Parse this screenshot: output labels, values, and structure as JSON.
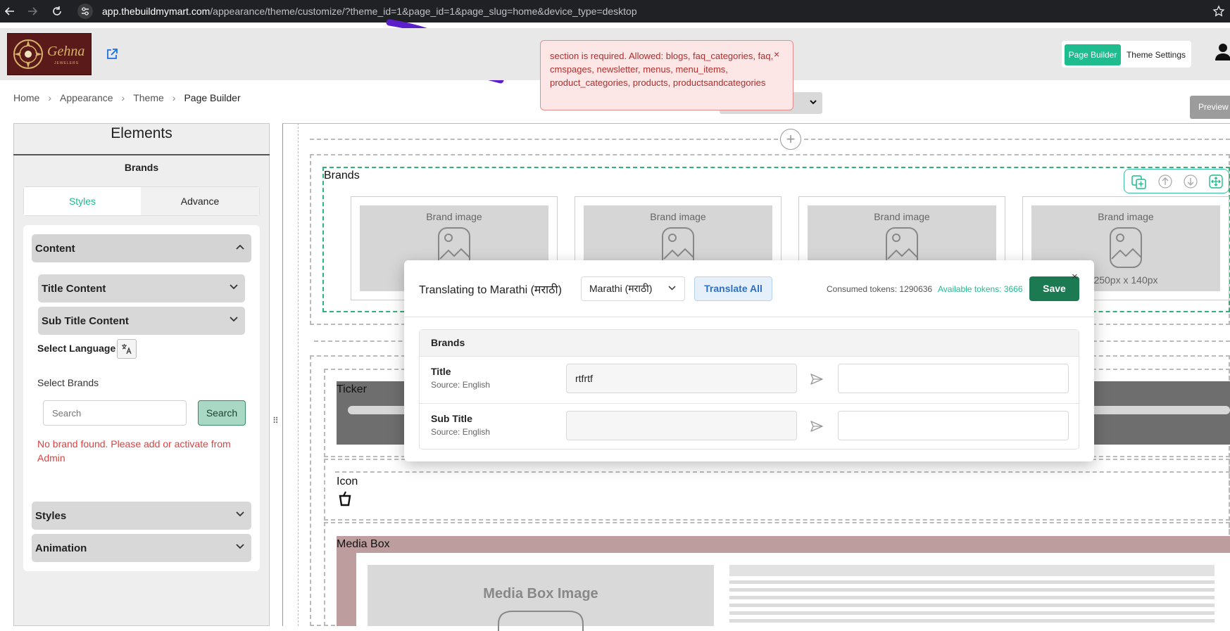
{
  "browser": {
    "url_host": "app.thebuildmymart.com",
    "url_path": "/appearance/theme/customize/?theme_id=1&page_id=1&page_slug=home&device_type=desktop"
  },
  "header": {
    "logo_text": "Gehna",
    "logo_sub": "JEWELERS",
    "tab_page_builder": "Page Builder",
    "tab_theme_settings": "Theme Settings"
  },
  "breadcrumb": [
    "Home",
    "Appearance",
    "Theme",
    "Page Builder"
  ],
  "preview_label": "Preview",
  "sidebar": {
    "title": "Elements",
    "element_name": "Brands",
    "tabs": [
      "Styles",
      "Advance"
    ],
    "active_tab": "Styles",
    "content_accordion": "Content",
    "title_content": "Title Content",
    "sub_title_content": "Sub Title Content",
    "select_language": "Select Language",
    "select_brands": "Select Brands",
    "search_placeholder": "Search",
    "search_button": "Search",
    "no_brand_message": "No brand found. Please add or activate from Admin",
    "styles_accordion": "Styles",
    "animation_accordion": "Animation"
  },
  "canvas": {
    "brands_title": "Brands",
    "brand_image_label": "Brand image",
    "brand_size_label": "250px x 140px",
    "ticker_title": "Ticker",
    "icon_title": "Icon",
    "mediabox_title": "Media Box",
    "mediabox_image_label": "Media Box Image"
  },
  "error_toast": {
    "message": "section is required. Allowed: blogs, faq_categories, faq, cmspages, newsletter, menus, menu_items, product_categories, products, productsandcategories",
    "close": "×"
  },
  "modal": {
    "title": "Translating to Marathi (मराठी)",
    "language_selected": "Marathi (मराठी)",
    "translate_all": "Translate All",
    "consumed_tokens": "Consumed tokens: 1290636",
    "available_tokens": "Available tokens: 3666",
    "save": "Save",
    "close": "×",
    "section_label": "Brands",
    "rows": [
      {
        "label": "Title",
        "source": "Source: English",
        "source_value": "rtfrtf",
        "target_value": ""
      },
      {
        "label": "Sub Title",
        "source": "Source: English",
        "source_value": "",
        "target_value": ""
      }
    ]
  },
  "colors": {
    "accent": "#1ebc8f",
    "save_green": "#1b7a52",
    "error_text": "#b02d2d",
    "annotation": "#5b1fc9"
  }
}
